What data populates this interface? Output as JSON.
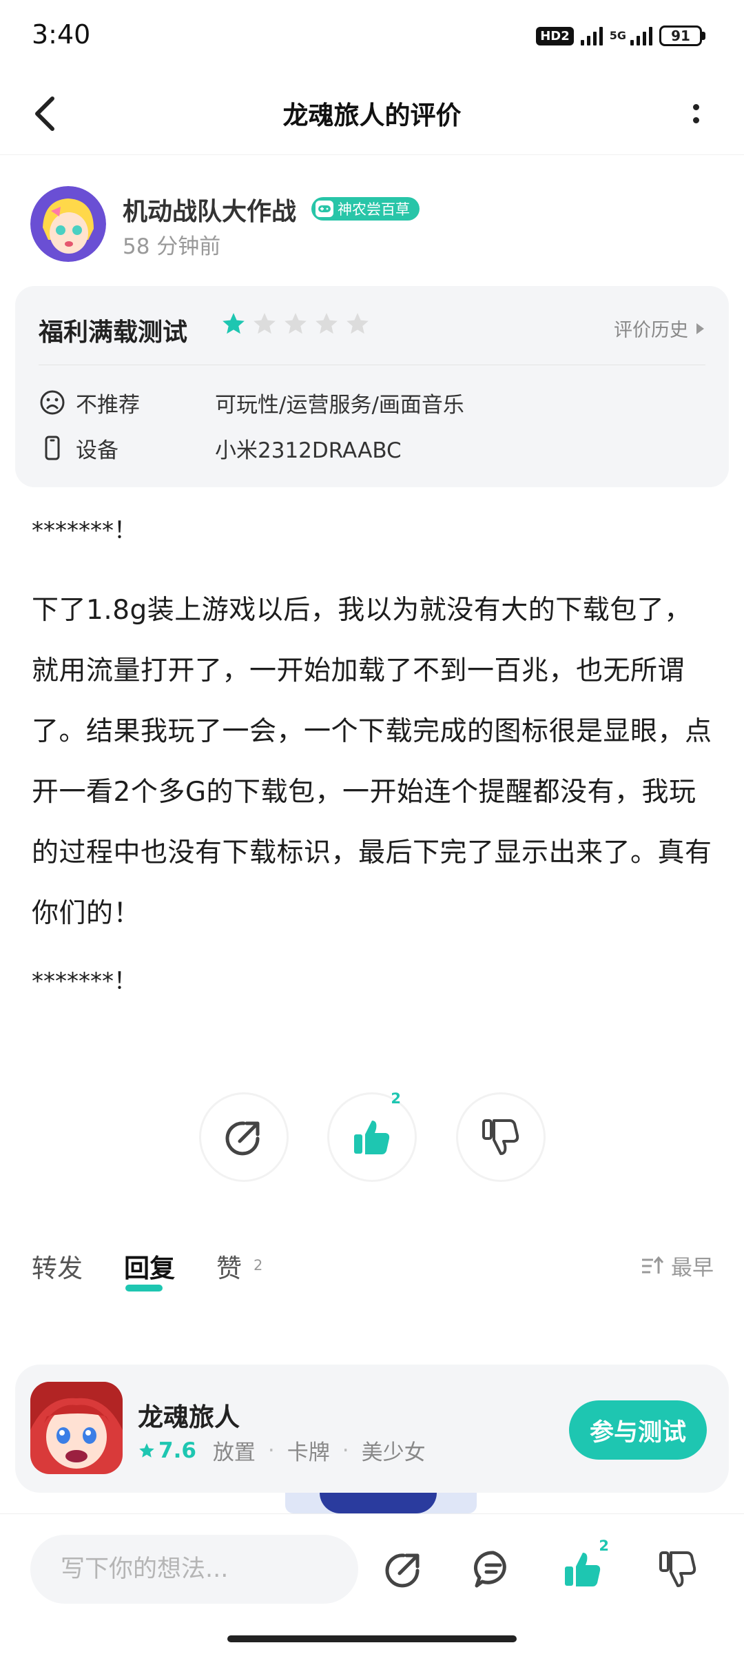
{
  "status_bar": {
    "time": "3:40",
    "hd_label": "HD2",
    "network_label": "5G",
    "battery": "91"
  },
  "header": {
    "title": "龙魂旅人的评价"
  },
  "author": {
    "name": "机动战队大作战",
    "badge": "神农尝百草",
    "time": "58 分钟前"
  },
  "review_card": {
    "title": "福利满载测试",
    "rating": 1,
    "max_rating": 5,
    "history_label": "评价历史",
    "rows": [
      {
        "icon": "sad-face-icon",
        "label": "不推荐",
        "value": "可玩性/运营服务/画面音乐"
      },
      {
        "icon": "phone-icon",
        "label": "设备",
        "value": "小米2312DRAABC"
      }
    ]
  },
  "review_body": {
    "line1": "*******！",
    "main": "下了1.8g装上游戏以后，我以为就没有大的下载包了，就用流量打开了，一开始加载了不到一百兆，也无所谓了。结果我玩了一会，一个下载完成的图标很是显眼，点开一看2个多G的下载包，一开始连个提醒都没有，我玩的过程中也没有下载标识，最后下完了显示出来了。真有你们的！",
    "line_last": "*******！"
  },
  "actions": {
    "like_count": "2"
  },
  "tabs": {
    "items": [
      "转发",
      "回复",
      "赞"
    ],
    "active": "回复",
    "like_count": "2",
    "sort_label": "最早"
  },
  "game": {
    "name": "龙魂旅人",
    "score": "7.6",
    "tags": [
      "放置",
      "卡牌",
      "美少女"
    ],
    "button_label": "参与测试"
  },
  "bottom_bar": {
    "input_placeholder": "写下你的想法...",
    "like_count": "2"
  },
  "colors": {
    "accent": "#1ec6b1",
    "tag_green": "#28c5a8",
    "card_bg": "#f4f5f7"
  }
}
